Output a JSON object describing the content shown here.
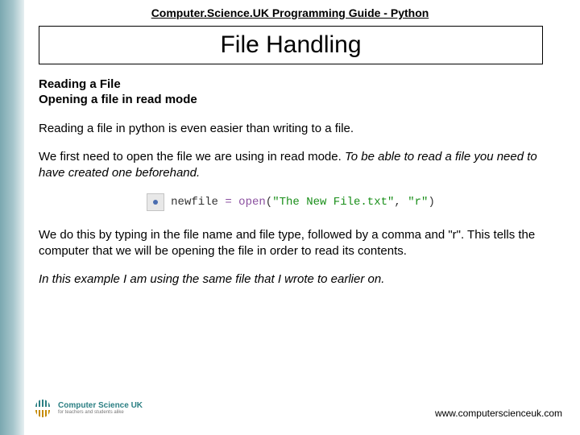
{
  "header": "Computer.Science.UK Programming Guide - Python",
  "title": "File Handling",
  "subheading1": "Reading a File",
  "subheading2": "Opening a file in read mode",
  "para1": "Reading a file in python is even easier than writing to a file.",
  "para2_a": "We first need to open the file we are using in read mode. ",
  "para2_b": "To be able to read a file you need to have created one beforehand.",
  "code": {
    "var": "newfile",
    "op": " = ",
    "fn": "open",
    "lp": "(",
    "arg1": "\"The New File.txt\"",
    "comma": ", ",
    "arg2": "\"r\"",
    "rp": ")"
  },
  "para3": "We do this by typing in the file name and file type, followed by a comma and \"r\". This tells the computer that we will be opening the file  in order to read its contents.",
  "para4": "In this example I am using the same file that I  wrote to earlier on.",
  "logo": {
    "line1": "Computer Science UK",
    "line2": "for teachers and students alike"
  },
  "footer_url": "www.computerscienceuk.com"
}
